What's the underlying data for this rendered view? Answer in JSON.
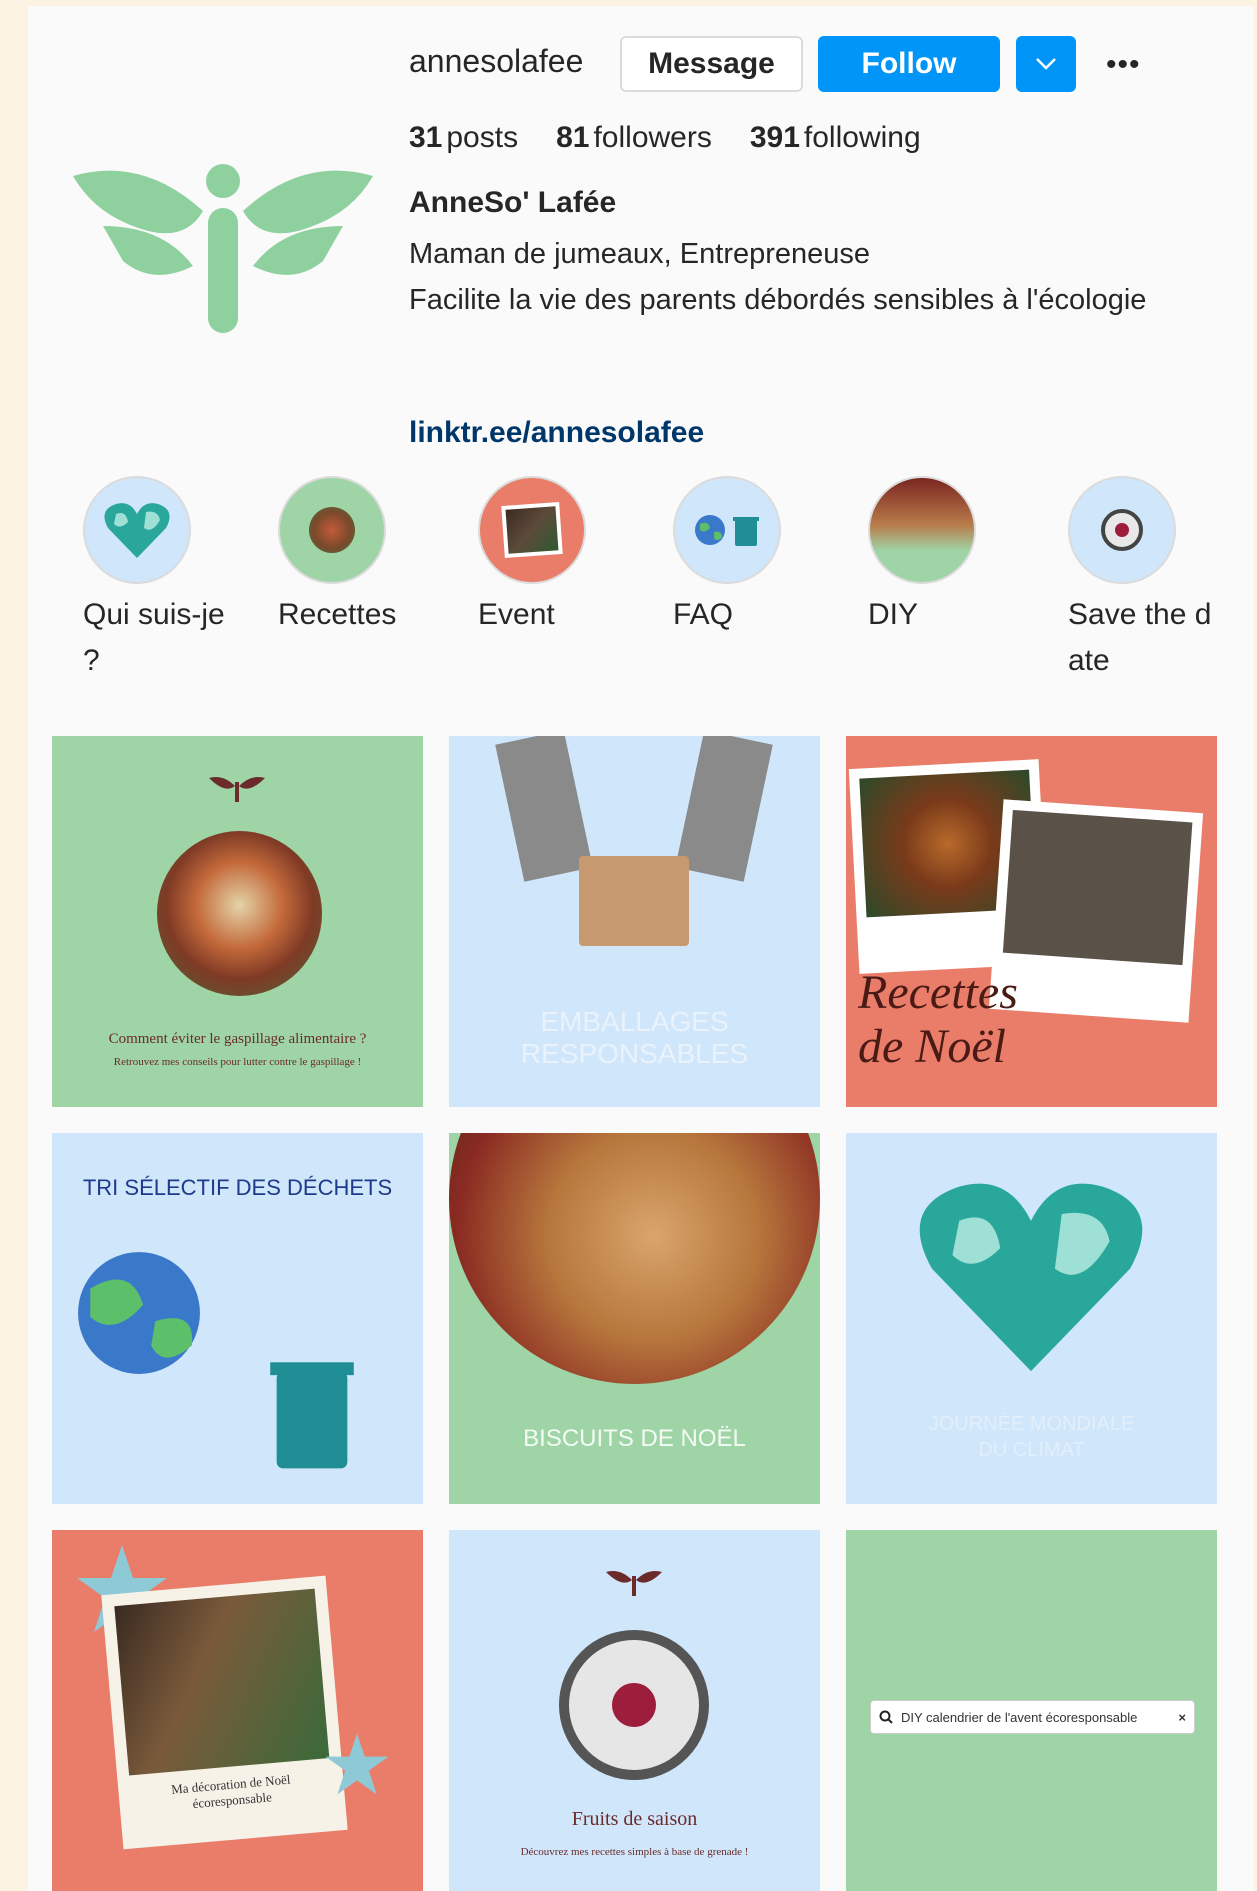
{
  "profile": {
    "username": "annesolafee",
    "message_label": "Message",
    "follow_label": "Follow",
    "more_label": "•••",
    "dropdown_icon": "chevron-down-icon",
    "stats": [
      {
        "value": "31",
        "label": "posts"
      },
      {
        "value": "81",
        "label": "followers"
      },
      {
        "value": "391",
        "label": "following"
      }
    ],
    "full_name": "AnneSo' Lafée",
    "bio_line1": "Maman de jumeaux, Entrepreneuse",
    "bio_line2": "Facilite la vie des parents débordés sensibles à l'écologie",
    "link": "linktr.ee/annesolafee"
  },
  "highlights": [
    {
      "label": "Qui suis-je ?"
    },
    {
      "label": "Recettes"
    },
    {
      "label": "Event"
    },
    {
      "label": "FAQ"
    },
    {
      "label": "DIY"
    },
    {
      "label": "Save the date"
    }
  ],
  "posts": {
    "p1_title": "Comment éviter le gaspillage alimentaire ?",
    "p1_sub": "Retrouvez mes conseils pour lutter contre le gaspillage !",
    "p2_text": "EMBALLAGES RESPONSABLES",
    "p3_text": "Recettes de Noël",
    "p4_text": "TRI SÉLECTIF DES DÉCHETS",
    "p5_text": "BISCUITS DE NOËL",
    "p6_text": "JOURNÉE MONDIALE DU CLIMAT",
    "p7_text": "Ma décoration de Noël écoresponsable",
    "p8_title": "Fruits de saison",
    "p8_sub": "Découvrez mes recettes simples à base de grenade !",
    "p9_search": "DIY calendrier de l'avent écoresponsable",
    "p9_close": "×"
  },
  "colors": {
    "follow_blue": "#0095f6",
    "tile_green": "#9fd4a6",
    "tile_blue": "#cfe6fb",
    "tile_coral": "#ea7d69",
    "link_color": "#00376b"
  }
}
